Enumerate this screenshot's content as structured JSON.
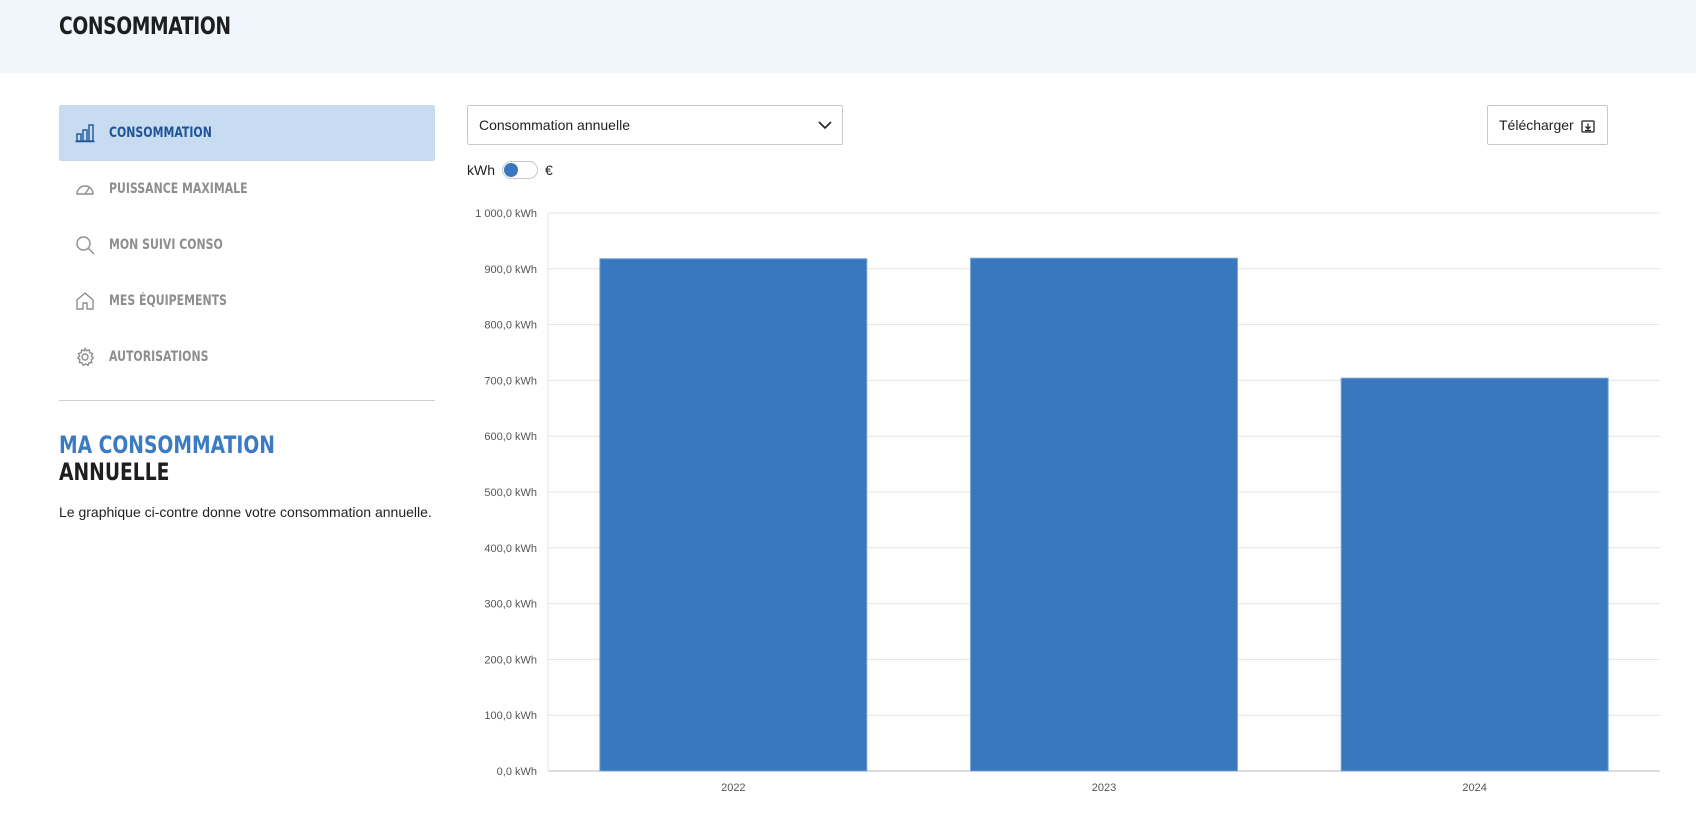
{
  "header": {
    "title": "CONSOMMATION"
  },
  "sidebar": {
    "items": [
      {
        "label": "CONSOMMATION",
        "icon": "bar-chart-icon",
        "active": true
      },
      {
        "label": "PUISSANCE MAXIMALE",
        "icon": "gauge-icon",
        "active": false
      },
      {
        "label": "MON SUIVI CONSO",
        "icon": "search-icon",
        "active": false
      },
      {
        "label": "MES ÉQUIPEMENTS",
        "icon": "home-icon",
        "active": false
      },
      {
        "label": "AUTORISATIONS",
        "icon": "gear-icon",
        "active": false
      }
    ]
  },
  "info": {
    "title_line1": "MA CONSOMMATION",
    "title_line2": "ANNUELLE",
    "text": "Le graphique ci-contre donne votre consommation annuelle."
  },
  "controls": {
    "period_select": "Consommation annuelle",
    "download_label": "Télécharger",
    "unit_left": "kWh",
    "unit_right": "€"
  },
  "colors": {
    "bar": "#3a78bd",
    "accent": "#3a7bc1",
    "active_bg": "#c7dbf1"
  },
  "chart_data": {
    "type": "bar",
    "categories": [
      "2022",
      "2023",
      "2024"
    ],
    "values": [
      918,
      919,
      704
    ],
    "ylim": [
      0,
      1000
    ],
    "yticks": [
      0,
      100,
      200,
      300,
      400,
      500,
      600,
      700,
      800,
      900,
      1000
    ],
    "ytick_labels": [
      "0,0 kWh",
      "100,0 kWh",
      "200,0 kWh",
      "300,0 kWh",
      "400,0 kWh",
      "500,0 kWh",
      "600,0 kWh",
      "700,0 kWh",
      "800,0 kWh",
      "900,0 kWh",
      "1 000,0 kWh"
    ],
    "grid": true,
    "title": "",
    "xlabel": "",
    "ylabel": ""
  }
}
